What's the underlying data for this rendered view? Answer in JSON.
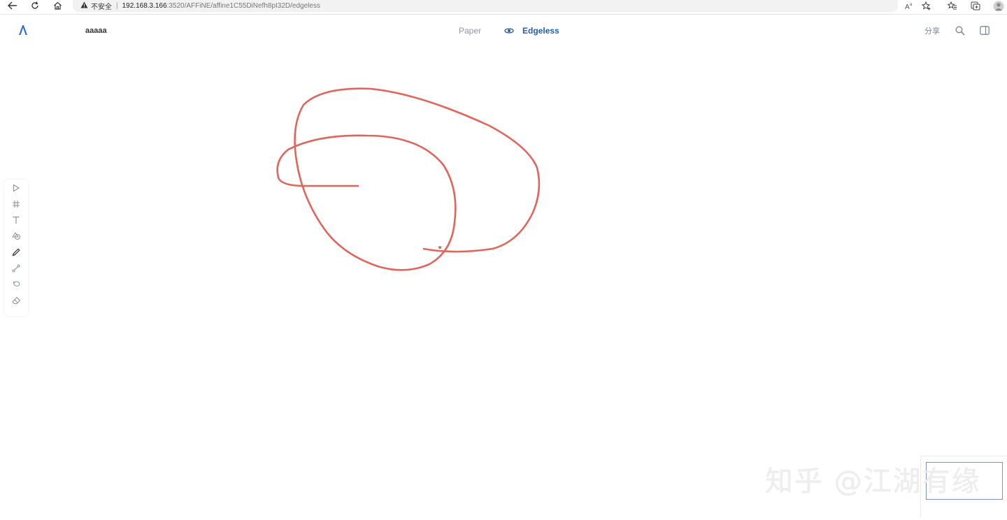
{
  "browser": {
    "security_label": "不安全",
    "url_host": "192.168.3.166",
    "url_path": ":3520/AFFiNE/affine1C55DiNefh8pI32D/edgeless",
    "read_aloud_label": "Aᵃ"
  },
  "header": {
    "doc_title": "aaaaa",
    "mode_paper": "Paper",
    "mode_edgeless": "Edgeless",
    "share_label": "分享"
  },
  "toolbar": {
    "tools": [
      "select",
      "frame",
      "text",
      "shape",
      "pen",
      "connector",
      "lasso",
      "eraser"
    ],
    "active_tool": "pen"
  },
  "canvas": {
    "stroke_color": "#e0655c"
  },
  "watermark": {
    "text": "知乎 @江湖有缘"
  }
}
